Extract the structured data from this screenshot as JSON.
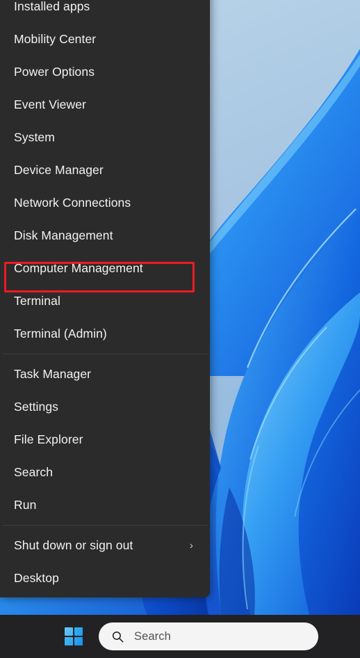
{
  "desktop": {
    "wallpaper_name": "windows-11-bloom-wallpaper",
    "sky_color": "#b6d2e8",
    "ribbon_color": "#1f7fe5",
    "deep_blue": "#0c3fc4"
  },
  "winx_menu": {
    "name": "power-user-menu",
    "background_color": "#2b2b2b",
    "highlight": {
      "target_item": "Computer Management",
      "border_color": "#ee1b24"
    },
    "groups": [
      {
        "items": [
          {
            "label": "Installed apps",
            "submenu": false
          },
          {
            "label": "Mobility Center",
            "submenu": false
          },
          {
            "label": "Power Options",
            "submenu": false
          },
          {
            "label": "Event Viewer",
            "submenu": false
          },
          {
            "label": "System",
            "submenu": false
          },
          {
            "label": "Device Manager",
            "submenu": false
          },
          {
            "label": "Network Connections",
            "submenu": false
          },
          {
            "label": "Disk Management",
            "submenu": false
          },
          {
            "label": "Computer Management",
            "submenu": false
          },
          {
            "label": "Terminal",
            "submenu": false
          },
          {
            "label": "Terminal (Admin)",
            "submenu": false
          }
        ]
      },
      {
        "items": [
          {
            "label": "Task Manager",
            "submenu": false
          },
          {
            "label": "Settings",
            "submenu": false
          },
          {
            "label": "File Explorer",
            "submenu": false
          },
          {
            "label": "Search",
            "submenu": false
          },
          {
            "label": "Run",
            "submenu": false
          }
        ]
      },
      {
        "items": [
          {
            "label": "Shut down or sign out",
            "submenu": true,
            "chevron": "›"
          },
          {
            "label": "Desktop",
            "submenu": false
          }
        ]
      }
    ]
  },
  "taskbar": {
    "background_color": "#222224",
    "start_button": {
      "name": "start-button",
      "icon": "windows-logo-icon"
    },
    "search": {
      "icon": "search-icon",
      "placeholder": "Search",
      "value": "",
      "background_color": "#f4f4f4",
      "text_color": "#515151"
    }
  }
}
